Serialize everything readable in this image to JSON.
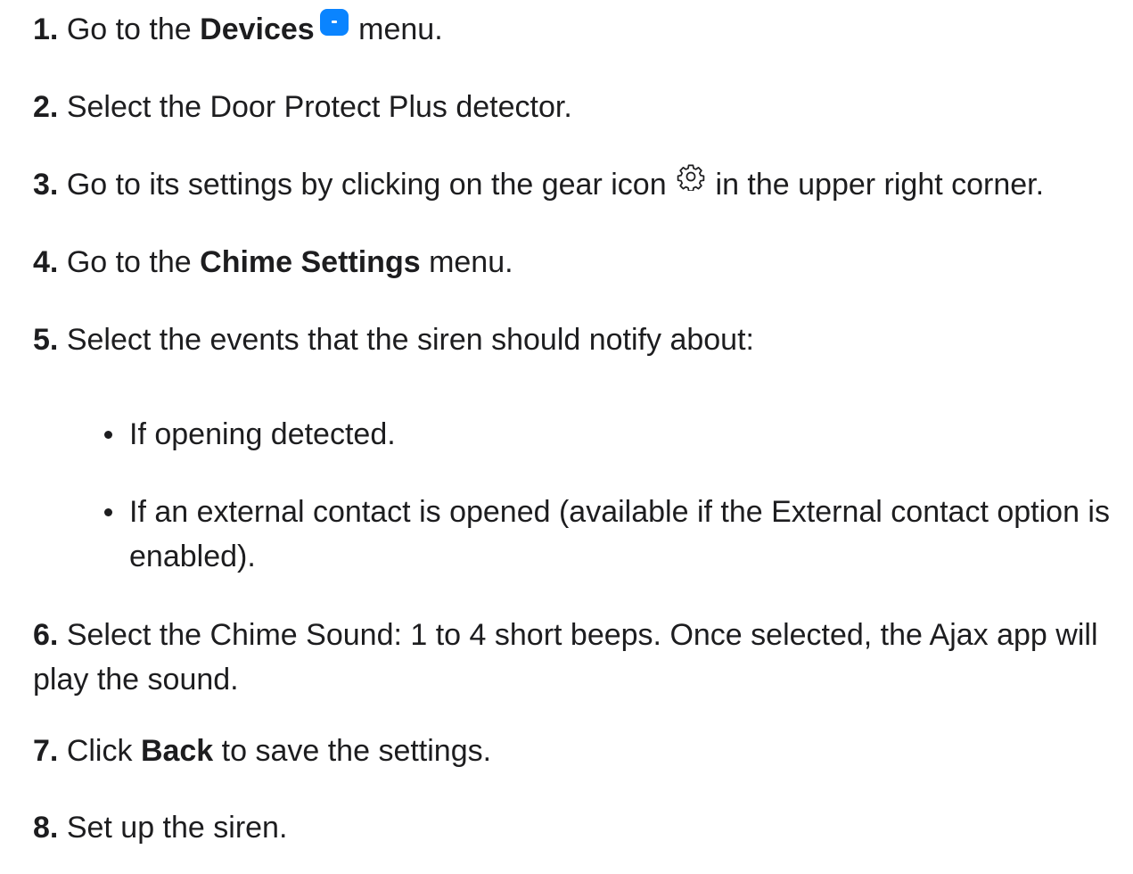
{
  "steps": [
    {
      "num": "1.",
      "before": "Go to the",
      "bold": "Devices",
      "after": "menu.",
      "icon": "devices-icon"
    },
    {
      "num": "2.",
      "text": "Select the Door Protect Plus detector."
    },
    {
      "num": "3.",
      "before": "Go to its settings by clicking on the gear icon",
      "after": "in the upper right corner.",
      "icon": "gear-icon"
    },
    {
      "num": "4.",
      "before": "Go to the",
      "bold": "Chime Settings",
      "after": "menu."
    },
    {
      "num": "5.",
      "text": "Select the events that the siren should notify about:"
    },
    {
      "num": "6.",
      "text": "Select the Chime Sound: 1 to 4 short beeps. Once selected, the Ajax app will play the sound."
    },
    {
      "num": "7.",
      "before": "Click",
      "bold": "Back",
      "after": "to save the settings."
    },
    {
      "num": "8.",
      "text": "Set up the siren."
    }
  ],
  "events": [
    "If opening detected.",
    "If an external contact is opened (available if the External contact option is enabled)."
  ],
  "colors": {
    "text": "#1d1d1f",
    "devices_icon": "#0a84ff"
  }
}
